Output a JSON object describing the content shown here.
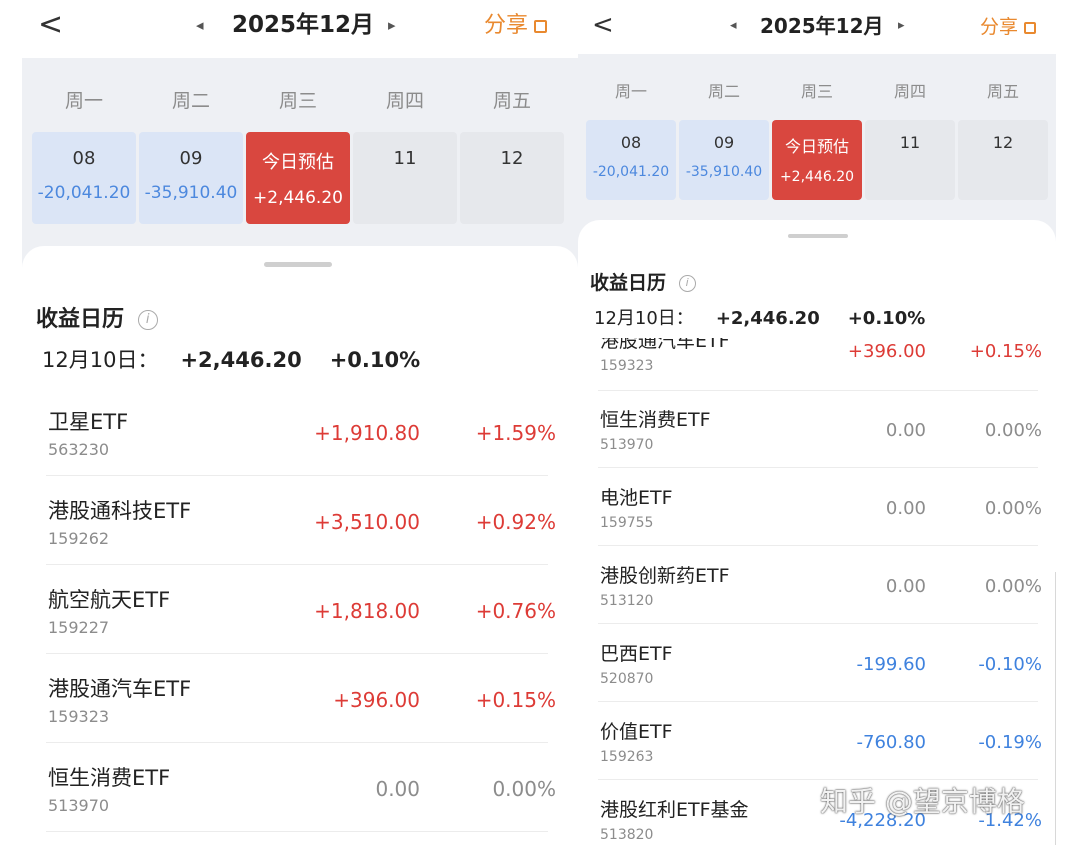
{
  "header": {
    "back_glyph": "<",
    "month": "2025年12月",
    "prev_glyph": "◂",
    "next_glyph": "▸",
    "share_label": "分享"
  },
  "weekdays": [
    "周一",
    "周二",
    "周三",
    "周四",
    "周五"
  ],
  "days": [
    {
      "date": "08",
      "value": "-20,041.20"
    },
    {
      "date": "09",
      "value": "-35,910.40"
    },
    {
      "date": "今日预估",
      "value": "+2,446.20"
    },
    {
      "date": "11",
      "value": ""
    },
    {
      "date": "12",
      "value": ""
    }
  ],
  "section": {
    "title": "收益日历",
    "info_glyph": "i"
  },
  "summary": {
    "date_label": "12月10日：",
    "amount": "+2,446.20",
    "percent": "+0.10%"
  },
  "left_rows": [
    {
      "name": "卫星ETF",
      "code": "563230",
      "amount": "+1,910.80",
      "percent": "+1.59%"
    },
    {
      "name": "港股通科技ETF",
      "code": "159262",
      "amount": "+3,510.00",
      "percent": "+0.92%"
    },
    {
      "name": "航空航天ETF",
      "code": "159227",
      "amount": "+1,818.00",
      "percent": "+0.76%"
    },
    {
      "name": "港股通汽车ETF",
      "code": "159323",
      "amount": "+396.00",
      "percent": "+0.15%"
    },
    {
      "name": "恒生消费ETF",
      "code": "513970",
      "amount": "0.00",
      "percent": "0.00%"
    }
  ],
  "right_rows": [
    {
      "name": "港股通汽车ETF",
      "code": "159323",
      "amount": "+396.00",
      "percent": "+0.15%"
    },
    {
      "name": "恒生消费ETF",
      "code": "513970",
      "amount": "0.00",
      "percent": "0.00%"
    },
    {
      "name": "电池ETF",
      "code": "159755",
      "amount": "0.00",
      "percent": "0.00%"
    },
    {
      "name": "港股创新药ETF",
      "code": "513120",
      "amount": "0.00",
      "percent": "0.00%"
    },
    {
      "name": "巴西ETF",
      "code": "520870",
      "amount": "-199.60",
      "percent": "-0.10%"
    },
    {
      "name": "价值ETF",
      "code": "159263",
      "amount": "-760.80",
      "percent": "-0.19%"
    },
    {
      "name": "港股红利ETF基金",
      "code": "513820",
      "amount": "-4,228.20",
      "percent": "-1.42%"
    }
  ],
  "watermark": "知乎 @望京博格",
  "colors": {
    "positive": "#dd3b36",
    "negative": "#3f82de",
    "neutral": "#8c8c8c",
    "today": "#d9473f",
    "accent": "#e9892f"
  }
}
